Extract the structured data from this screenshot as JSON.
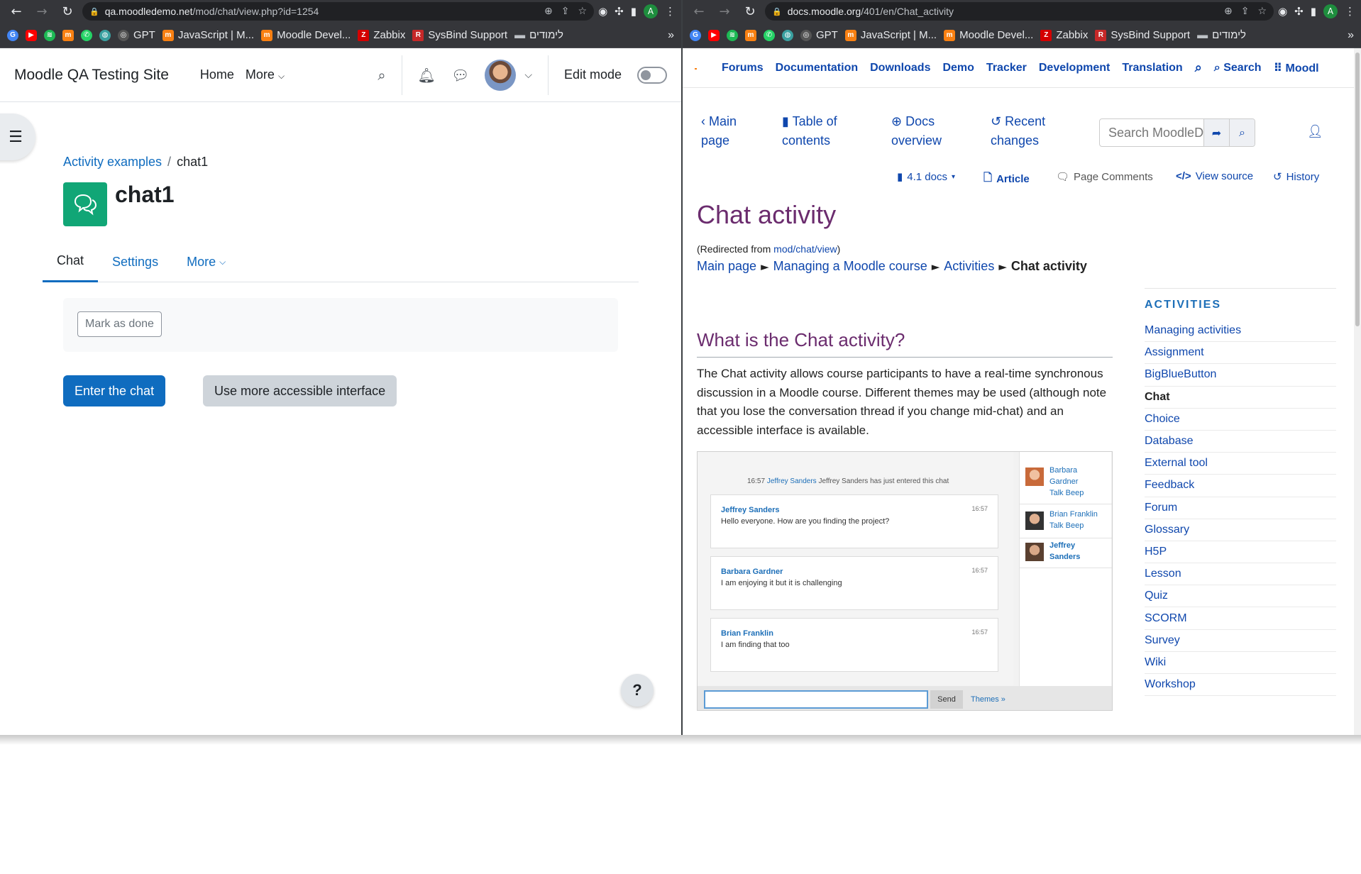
{
  "bookmarks": [
    "GPT",
    "JavaScript | M...",
    "Moodle Devel...",
    "Zabbix",
    "SysBind Support",
    "לימודים"
  ],
  "left": {
    "url_host": "qa.moodledemo.net",
    "url_path": "/mod/chat/view.php?id=1254",
    "site_name": "Moodle QA Testing Site",
    "nav_home": "Home",
    "nav_more": "More",
    "edit_mode": "Edit mode",
    "breadcrumb_parent": "Activity examples",
    "breadcrumb_sep": "/",
    "breadcrumb_current": "chat1",
    "activity_title": "chat1",
    "tabs": [
      "Chat",
      "Settings",
      "More"
    ],
    "mark_done": "Mark as done",
    "enter_chat": "Enter the chat",
    "accessible": "Use more accessible interface",
    "help": "?"
  },
  "right": {
    "url_host": "docs.moodle.org",
    "url_path": "/401/en/Chat_activity",
    "topnav": [
      "Forums",
      "Documentation",
      "Downloads",
      "Demo",
      "Tracker",
      "Development",
      "Translation"
    ],
    "topnav_search": "Search",
    "topnav_cut": "Moodl",
    "tool_main": [
      "Main",
      "page"
    ],
    "tool_toc": [
      "Table of",
      "contents"
    ],
    "tool_docs": [
      "Docs",
      "overview"
    ],
    "tool_recent": [
      "Recent",
      "changes"
    ],
    "search_placeholder": "Search MoodleDc",
    "actions": [
      "4.1 docs",
      "Article",
      "Page Comments",
      "View source",
      "History"
    ],
    "page_title": "Chat activity",
    "redirect_prefix": "(Redirected from ",
    "redirect_link": "mod/chat/view",
    "redirect_suffix": ")",
    "crumbs": [
      "Main page",
      "Managing a Moodle course",
      "Activities",
      "Chat activity"
    ],
    "h2": "What is the Chat activity?",
    "para": "The Chat activity allows course participants to have a real-time synchronous discussion in a Moodle course. Different themes may be used (although note that you lose the conversation thread if you change mid-chat) and an accessible interface is available.",
    "chat_image": {
      "system_time": "16:57",
      "system_user": "Jeffrey Sanders",
      "system_text": "Jeffrey Sanders has just entered this chat",
      "messages": [
        {
          "who": "Jeffrey Sanders",
          "time": "16:57",
          "text": "Hello everyone. How are you finding the project?"
        },
        {
          "who": "Barbara Gardner",
          "time": "16:57",
          "text": "I am enjoying it but it is challenging"
        },
        {
          "who": "Brian Franklin",
          "time": "16:57",
          "text": "I am finding that too"
        }
      ],
      "users": [
        {
          "line1": "Barbara",
          "line2": "Gardner",
          "line3": "Talk Beep"
        },
        {
          "line1": "Brian Franklin",
          "line2": "Talk Beep",
          "line3": ""
        },
        {
          "line1": "Jeffrey",
          "line2": "Sanders",
          "line3": ""
        }
      ],
      "send": "Send",
      "themes": "Themes »"
    },
    "sidebar_heading": "ACTIVITIES",
    "sidebar_items": [
      "Managing activities",
      "Assignment",
      "BigBlueButton",
      "Chat",
      "Choice",
      "Database",
      "External tool",
      "Feedback",
      "Forum",
      "Glossary",
      "H5P",
      "Lesson",
      "Quiz",
      "SCORM",
      "Survey",
      "Wiki",
      "Workshop"
    ]
  },
  "colors": {
    "moodle_primary": "#0f6cbf",
    "chat_icon_bg": "#11a676",
    "docs_link": "#0f47ad",
    "docs_title": "#6b2c6e"
  }
}
